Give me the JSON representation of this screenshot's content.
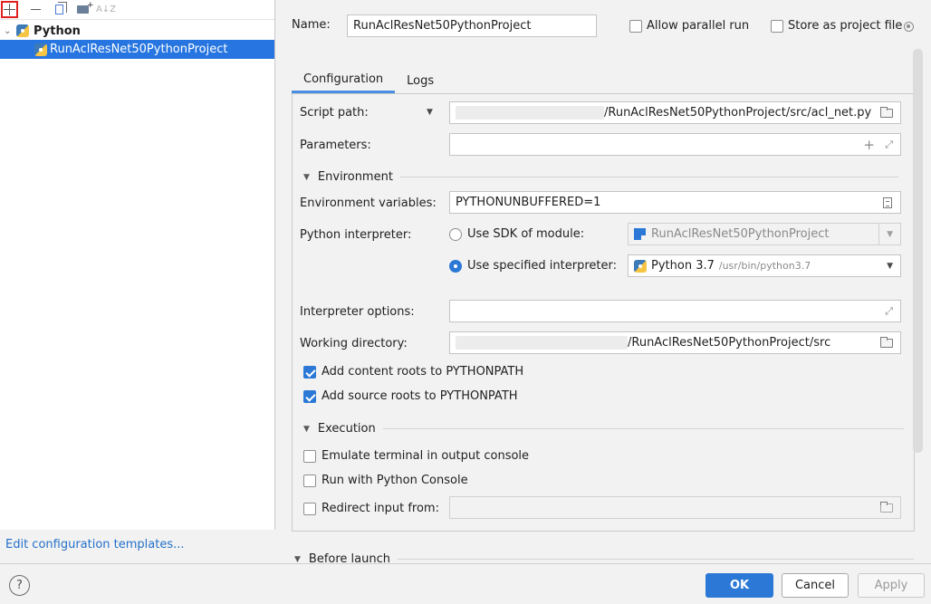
{
  "toolbar": {
    "add_icon": "plus-icon",
    "remove_icon": "minus-icon",
    "copy_icon": "copy-icon",
    "folder_icon": "new-folder-icon",
    "sort_label": "A↓Z"
  },
  "tree": {
    "parent_label": "Python",
    "child_label": "RunAclResNet50PythonProject"
  },
  "left_footer": {
    "edit_templates": "Edit configuration templates..."
  },
  "header": {
    "name_label": "Name:",
    "name_value": "RunAclResNet50PythonProject",
    "allow_parallel": "Allow parallel run",
    "store_as_file": "Store as project file"
  },
  "tabs": [
    {
      "label": "Configuration",
      "active": true
    },
    {
      "label": "Logs",
      "active": false
    }
  ],
  "config": {
    "script_path_label": "Script path:",
    "script_path_value": "/RunAclResNet50PythonProject/src/acl_net.py",
    "parameters_label": "Parameters:",
    "parameters_value": "",
    "environment_header": "Environment",
    "env_vars_label": "Environment variables:",
    "env_vars_value": "PYTHONUNBUFFERED=1",
    "interpreter_label": "Python interpreter:",
    "use_sdk_label": "Use SDK of module:",
    "sdk_module_value": "RunAclResNet50PythonProject",
    "use_specified_label": "Use specified interpreter:",
    "interpreter_name": "Python 3.7",
    "interpreter_path": "/usr/bin/python3.7",
    "interp_options_label": "Interpreter options:",
    "interp_options_value": "",
    "working_dir_label": "Working directory:",
    "working_dir_value": "/RunAclResNet50PythonProject/src",
    "add_content_roots": "Add content roots to PYTHONPATH",
    "add_source_roots": "Add source roots to PYTHONPATH",
    "execution_header": "Execution",
    "emulate_terminal": "Emulate terminal in output console",
    "run_with_console": "Run with Python Console",
    "redirect_input": "Redirect input from:",
    "redirect_value": ""
  },
  "before_launch_header": "Before launch",
  "buttons": {
    "help": "?",
    "ok": "OK",
    "cancel": "Cancel",
    "apply": "Apply"
  }
}
